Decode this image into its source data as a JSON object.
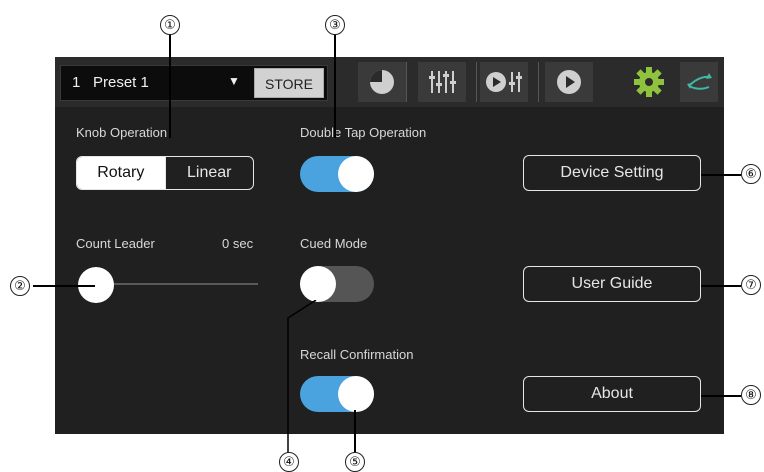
{
  "header": {
    "preset_number": "1",
    "preset_name": "Preset 1",
    "dropdown_arrow": "▼",
    "store_label": "STORE",
    "tabs": [
      {
        "icon": "meter-icon"
      },
      {
        "icon": "mixer-faders-icon"
      },
      {
        "icon": "play-mixer-icon"
      },
      {
        "icon": "play-icon"
      },
      {
        "icon": "gear-icon"
      },
      {
        "icon": "swap-arrows-icon"
      }
    ]
  },
  "settings": {
    "knob_operation": {
      "label": "Knob Operation",
      "options": [
        "Rotary",
        "Linear"
      ],
      "selected": "Rotary"
    },
    "count_leader": {
      "label": "Count Leader",
      "value": "0 sec",
      "slider_fraction": 0
    },
    "double_tap": {
      "label": "Double Tap Operation",
      "enabled": true
    },
    "cued_mode": {
      "label": "Cued Mode",
      "enabled": false
    },
    "recall_confirmation": {
      "label": "Recall Confirmation",
      "enabled": true
    }
  },
  "buttons": {
    "device_setting": "Device Setting",
    "user_guide": "User Guide",
    "about": "About"
  },
  "callouts": [
    "①",
    "②",
    "③",
    "④",
    "⑤",
    "⑥",
    "⑦",
    "⑧"
  ],
  "colors": {
    "screen_bg": "#202020",
    "toggle_on": "#4aa3df",
    "toggle_off": "#555555",
    "gear": "#8fc33e",
    "swap": "#3fb8a8"
  }
}
